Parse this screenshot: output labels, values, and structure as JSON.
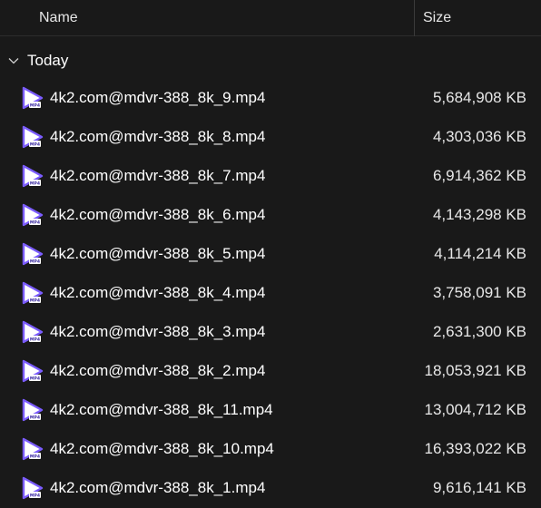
{
  "header": {
    "name_label": "Name",
    "size_label": "Size"
  },
  "group": {
    "label": "Today",
    "icon": "chevron-down-icon"
  },
  "files": [
    {
      "name": "4k2.com@mdvr-388_8k_9.mp4",
      "size": "5,684,908 KB",
      "icon": "mp4-video-icon"
    },
    {
      "name": "4k2.com@mdvr-388_8k_8.mp4",
      "size": "4,303,036 KB",
      "icon": "mp4-video-icon"
    },
    {
      "name": "4k2.com@mdvr-388_8k_7.mp4",
      "size": "6,914,362 KB",
      "icon": "mp4-video-icon"
    },
    {
      "name": "4k2.com@mdvr-388_8k_6.mp4",
      "size": "4,143,298 KB",
      "icon": "mp4-video-icon"
    },
    {
      "name": "4k2.com@mdvr-388_8k_5.mp4",
      "size": "4,114,214 KB",
      "icon": "mp4-video-icon"
    },
    {
      "name": "4k2.com@mdvr-388_8k_4.mp4",
      "size": "3,758,091 KB",
      "icon": "mp4-video-icon"
    },
    {
      "name": "4k2.com@mdvr-388_8k_3.mp4",
      "size": "2,631,300 KB",
      "icon": "mp4-video-icon"
    },
    {
      "name": "4k2.com@mdvr-388_8k_2.mp4",
      "size": "18,053,921 KB",
      "icon": "mp4-video-icon"
    },
    {
      "name": "4k2.com@mdvr-388_8k_11.mp4",
      "size": "13,004,712 KB",
      "icon": "mp4-video-icon"
    },
    {
      "name": "4k2.com@mdvr-388_8k_10.mp4",
      "size": "16,393,022 KB",
      "icon": "mp4-video-icon"
    },
    {
      "name": "4k2.com@mdvr-388_8k_1.mp4",
      "size": "9,616,141 KB",
      "icon": "mp4-video-icon"
    }
  ],
  "colors": {
    "background": "#191919",
    "icon_accent": "#7b5cff",
    "text": "#ffffff"
  }
}
